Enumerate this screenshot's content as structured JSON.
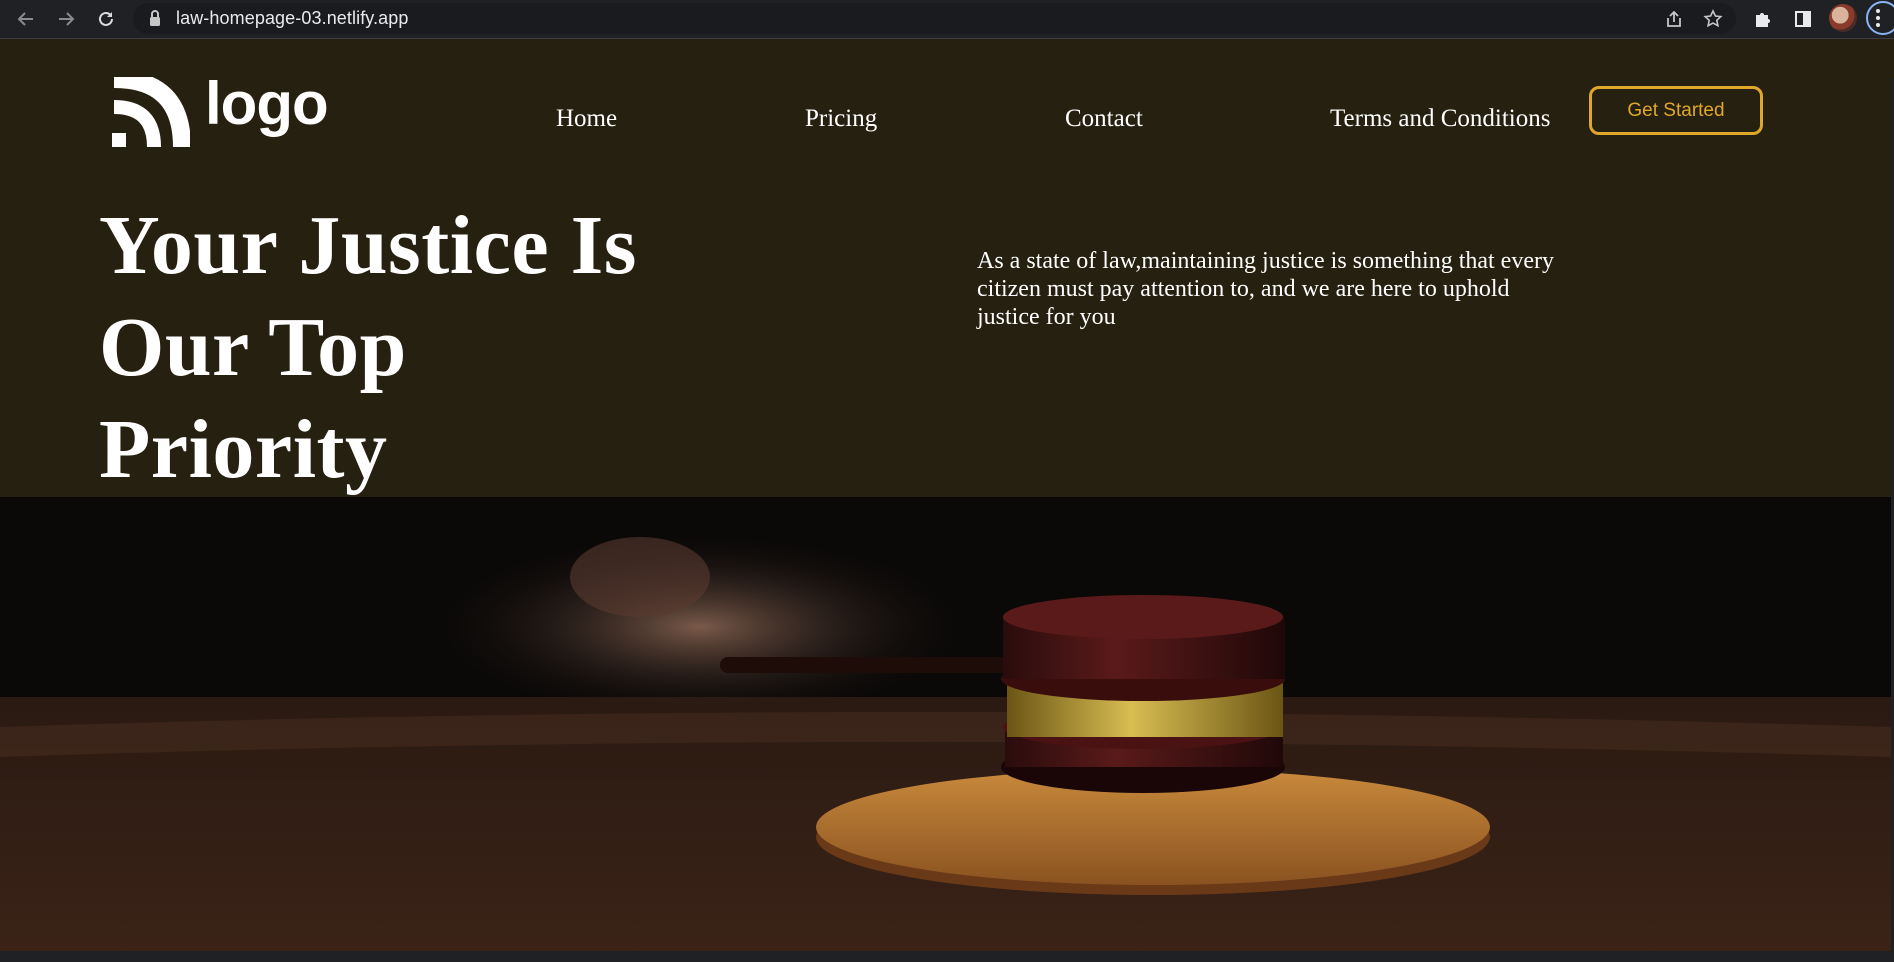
{
  "browser": {
    "url": "law-homepage-03.netlify.app",
    "icons": [
      "back-arrow-icon",
      "forward-arrow-icon",
      "reload-icon",
      "lock-icon",
      "share-icon",
      "bookmark-star-icon",
      "extensions-puzzle-icon",
      "side-panel-icon",
      "profile-avatar",
      "menu-dots-icon"
    ]
  },
  "header": {
    "logo_text": "logo",
    "nav": [
      {
        "label": "Home"
      },
      {
        "label": "Pricing"
      },
      {
        "label": "Contact"
      },
      {
        "label": "Terms and Conditions"
      }
    ],
    "cta_label": "Get Started"
  },
  "hero": {
    "title_line1": "Your Justice Is",
    "title_line2": "Our Top",
    "title_line3": "Priority",
    "description": "As a state of law,maintaining justice is something that every citizen must pay attention to, and we are here to uphold justice for you"
  },
  "colors": {
    "header_bg": "#262010",
    "accent": "#e0a82a",
    "text": "#ffffff"
  }
}
